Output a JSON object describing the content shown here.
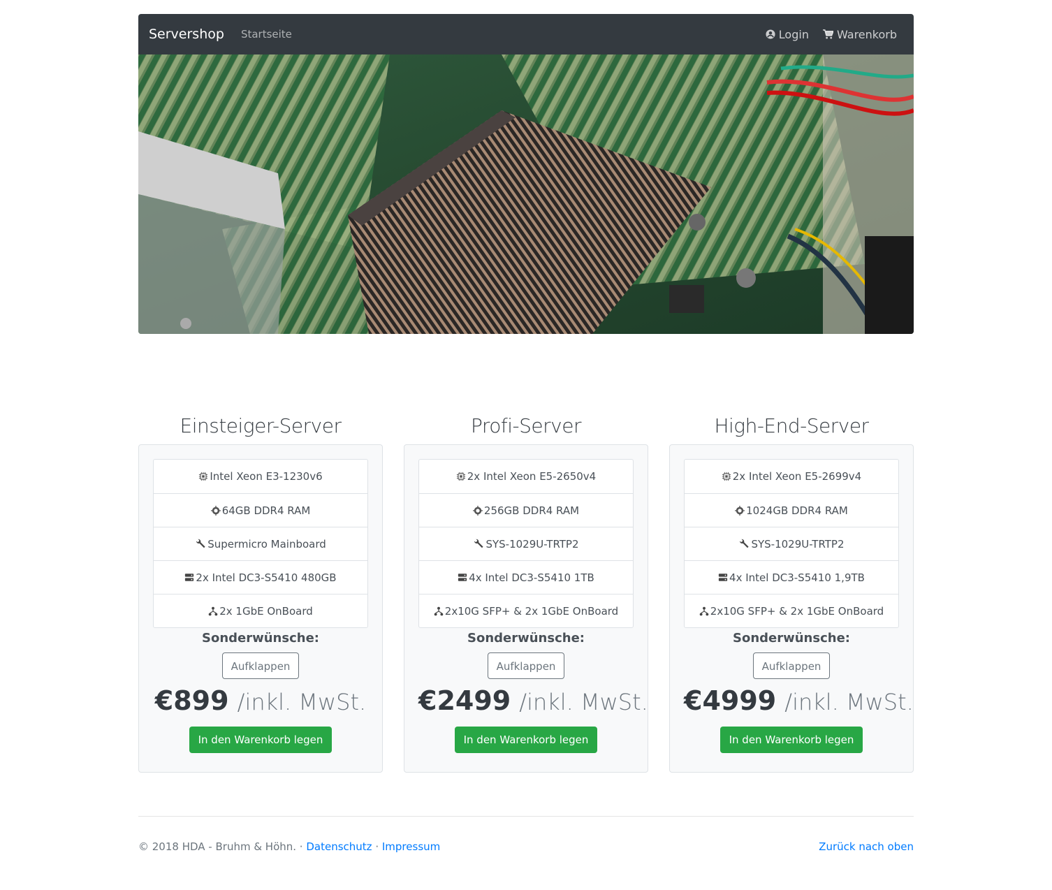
{
  "navbar": {
    "brand": "Servershop",
    "home": "Startseite",
    "login": "Login",
    "cart": "Warenkorb"
  },
  "hero": {
    "alt": "Server-Mainboard mit RAM und Kühlkörper"
  },
  "plans": [
    {
      "title": "Einsteiger-Server",
      "features": [
        {
          "icon": "cpu-icon",
          "text": "Intel Xeon E3-1230v6"
        },
        {
          "icon": "memory-icon",
          "text": "64GB DDR4 RAM"
        },
        {
          "icon": "wrench-icon",
          "text": "Supermicro Mainboard"
        },
        {
          "icon": "storage-icon",
          "text": "2x Intel DC3-S5410 480GB"
        },
        {
          "icon": "network-icon",
          "text": "2x 1GbE OnBoard"
        }
      ],
      "special_label": "Sonderwünsche:",
      "toggle_label": "Aufklappen",
      "price": "€899",
      "price_unit": "/inkl. MwSt.",
      "cart_label": "In den Warenkorb legen"
    },
    {
      "title": "Profi-Server",
      "features": [
        {
          "icon": "cpu-icon",
          "text": "2x Intel Xeon E5-2650v4"
        },
        {
          "icon": "memory-icon",
          "text": "256GB DDR4 RAM"
        },
        {
          "icon": "wrench-icon",
          "text": "SYS-1029U-TRTP2"
        },
        {
          "icon": "storage-icon",
          "text": "4x Intel DC3-S5410 1TB"
        },
        {
          "icon": "network-icon",
          "text": "2x10G SFP+ & 2x 1GbE OnBoard"
        }
      ],
      "special_label": "Sonderwünsche:",
      "toggle_label": "Aufklappen",
      "price": "€2499",
      "price_unit": "/inkl. MwSt.",
      "cart_label": "In den Warenkorb legen"
    },
    {
      "title": "High-End-Server",
      "features": [
        {
          "icon": "cpu-icon",
          "text": "2x Intel Xeon E5-2699v4"
        },
        {
          "icon": "memory-icon",
          "text": "1024GB DDR4 RAM"
        },
        {
          "icon": "wrench-icon",
          "text": "SYS-1029U-TRTP2"
        },
        {
          "icon": "storage-icon",
          "text": "4x Intel DC3-S5410 1,9TB"
        },
        {
          "icon": "network-icon",
          "text": "2x10G SFP+ & 2x 1GbE OnBoard"
        }
      ],
      "special_label": "Sonderwünsche:",
      "toggle_label": "Aufklappen",
      "price": "€4999",
      "price_unit": "/inkl. MwSt.",
      "cart_label": "In den Warenkorb legen"
    }
  ],
  "footer": {
    "copyright": "© 2018 HDA - Bruhm & Höhn. · ",
    "privacy": "Datenschutz",
    "sep": " · ",
    "imprint": "Impressum",
    "back_to_top": "Zurück nach oben"
  },
  "colors": {
    "navbar_bg": "#343a40",
    "success": "#28a745",
    "link": "#007bff"
  }
}
